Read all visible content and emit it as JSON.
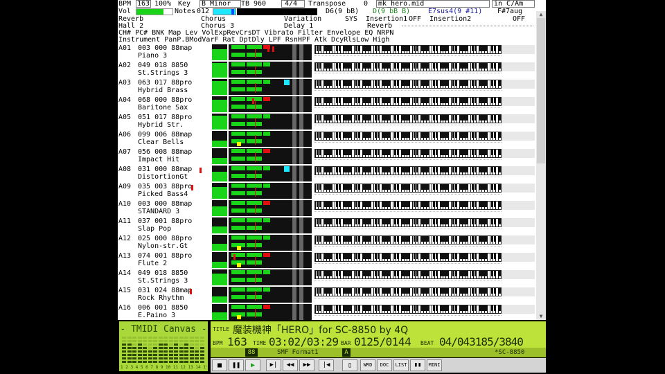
{
  "status": {
    "bpm_label": "BPM",
    "bpm": "163",
    "tempo_pct": "100%",
    "key_label": "Key",
    "key_value": "B Minor",
    "tb_label": "TB",
    "tb_value": "960",
    "timesig": "4/4",
    "transpose_label": "Transpose",
    "transpose_value": "0",
    "filename": "mk_hero.mid",
    "relative_key": "in C/Am",
    "vol_label": "Vol",
    "notes_label": "Notes",
    "notes_value": "012",
    "chord1": "D6(9 bB)",
    "chord2": "D(9 bB B)",
    "chord3": "E7sus4(9 #11)",
    "chord4": "F#7aug"
  },
  "effects": {
    "reverb": "Reverb",
    "reverb_value": "Hall 2",
    "chorus": "Chorus",
    "chorus_value": "Chorus 3",
    "variation": "Variation",
    "variation_value": "Delay 1",
    "sys_label": "SYS",
    "ins1_label": "Insertion1",
    "ins1_value": "OFF",
    "ins2_label": "Insertion2",
    "ins2_value": "OFF",
    "reverb2": "Reverb"
  },
  "headers": {
    "line1": "CH# PC# BNK Map  Lev VolExpRevCrsDT  Vibrato   Filter   Envelope EQ  NRPN",
    "line2": "    Instrument        PanP.BModVarF Rat DptDly LPF RsnHPF Atk DcyRlsLow High"
  },
  "channels": [
    {
      "ch": "A01",
      "prog": "003 000 88map",
      "name": "Piano 3"
    },
    {
      "ch": "A02",
      "prog": "049 018 8850",
      "name": "St.Strings 3"
    },
    {
      "ch": "A03",
      "prog": "063 017 88pro",
      "name": "Hybrid Brass"
    },
    {
      "ch": "A04",
      "prog": "068 000 88pro",
      "name": "Baritone Sax"
    },
    {
      "ch": "A05",
      "prog": "051 017 88pro",
      "name": "Hybrid Str."
    },
    {
      "ch": "A06",
      "prog": "099 006 88map",
      "name": "Clear Bells"
    },
    {
      "ch": "A07",
      "prog": "056 008 88map",
      "name": "Impact Hit"
    },
    {
      "ch": "A08",
      "prog": "031 000 88map",
      "name": "DistortionGt"
    },
    {
      "ch": "A09",
      "prog": "035 003 88pro",
      "name": "Picked Bass4"
    },
    {
      "ch": "A10",
      "prog": "003 000 88map",
      "name": "STANDARD 3"
    },
    {
      "ch": "A11",
      "prog": "037 001 88pro",
      "name": "Slap Pop"
    },
    {
      "ch": "A12",
      "prog": "025 000 88pro",
      "name": "Nylon-str.Gt"
    },
    {
      "ch": "A13",
      "prog": "074 001 88pro",
      "name": "Flute 2"
    },
    {
      "ch": "A14",
      "prog": "049 018 8850",
      "name": "St.Strings 3"
    },
    {
      "ch": "A15",
      "prog": "031 024 88map",
      "name": "Rock Rhythm"
    },
    {
      "ch": "A16",
      "prog": "006 001 8850",
      "name": "E.Paino 3"
    }
  ],
  "canvas_title": "- TMIDI Canvas -",
  "channel_numbers": "1 2 3 4 5 6 7 8 9 10 11 12 13 14 15 16",
  "song": {
    "title_label": "TITLE",
    "title": "魔装機神「HERO」for SC-8850 by 4Q",
    "bpm_label": "BPM",
    "bpm": "163",
    "time_label": "TIME",
    "time": "03:02/03:29",
    "bar_label": "BAR",
    "bar": "0125/0144",
    "beat_label": "BEAT",
    "beat": "04/043185/3840",
    "mode": "88",
    "format": "SMF Format1",
    "port": "A",
    "device": "*SC-8850"
  },
  "transport": {
    "wrd": "WRD",
    "doc": "DOC",
    "list": "LIST",
    "mini": "MINI"
  },
  "colors": {
    "lcd_bg": "#bde23a",
    "lcd_text": "#1a2a00",
    "meter_green": "#19d419",
    "meter_yellow": "#f5f500",
    "pan_cyan": "#1ee8ff",
    "note_red": "#e01010"
  }
}
